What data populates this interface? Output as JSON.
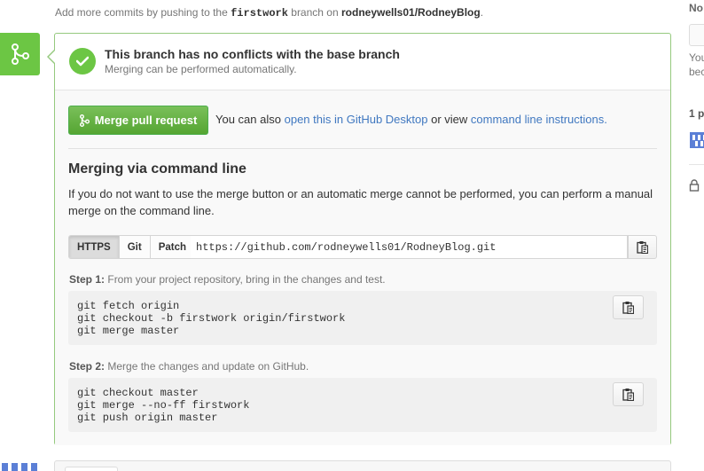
{
  "top_note": {
    "prefix": "Add more commits by pushing to the",
    "branch": "firstwork",
    "middle": "branch on",
    "repo": "rodneywells01/RodneyBlog",
    "suffix": "."
  },
  "status": {
    "title": "This branch has no conflicts with the base branch",
    "subtitle": "Merging can be performed automatically."
  },
  "merge": {
    "button_label": "Merge pull request",
    "alt_prefix": "You can also",
    "desktop_link": "open this in GitHub Desktop",
    "alt_middle": "or view",
    "cli_link": "command line instructions",
    "alt_suffix": "."
  },
  "command_line": {
    "title": "Merging via command line",
    "description": "If you do not want to use the merge button or an automatic merge cannot be performed, you can perform a manual merge on the command line.",
    "protocols": [
      "HTTPS",
      "Git",
      "Patch"
    ],
    "active_protocol": "HTTPS",
    "clone_url": "https://github.com/rodneywells01/RodneyBlog.git",
    "step1_label": "Step 1:",
    "step1_text": "From your project repository, bring in the changes and test.",
    "step1_code": "git fetch origin\ngit checkout -b firstwork origin/firstwork\ngit merge master",
    "step2_label": "Step 2:",
    "step2_text": "Merge the changes and update on GitHub.",
    "step2_code": "git checkout master\ngit merge --no-ff firstwork\ngit push origin master"
  },
  "sidebar": {
    "heading": "No",
    "text1": "You",
    "text2": "bec",
    "participants": "1 p"
  },
  "icons": {
    "merge_badge": "git-merge-icon",
    "status": "check-icon",
    "button": "git-merge-icon",
    "copy": "clipboard-icon",
    "lock": "lock-icon"
  },
  "colors": {
    "success_green": "#6cc644",
    "border_green": "#95c97e",
    "button_green": "#55a532",
    "link_blue": "#4078c0"
  }
}
